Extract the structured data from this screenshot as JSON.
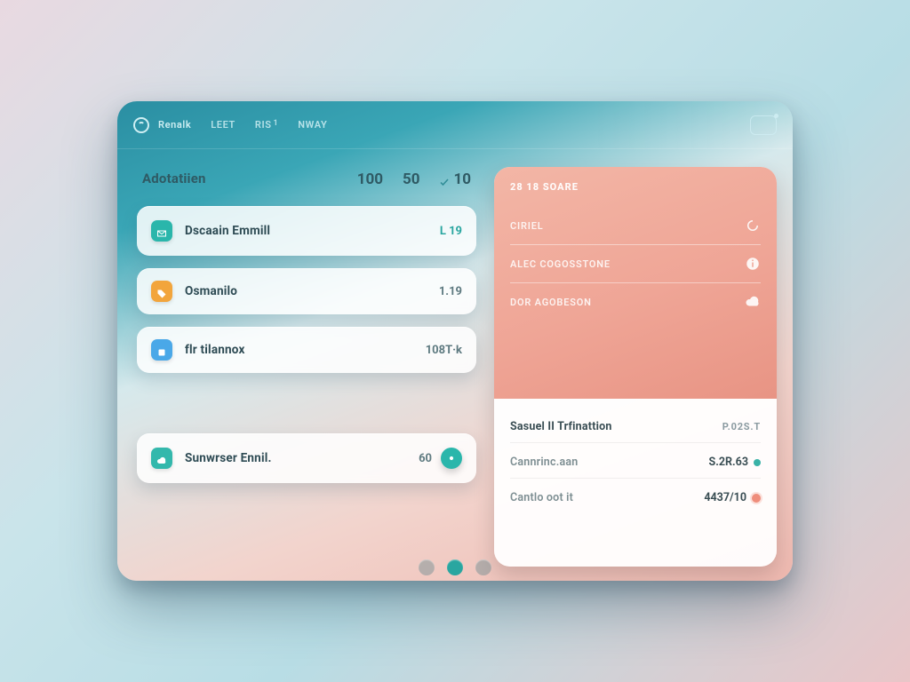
{
  "topbar": {
    "brand": "Renalk",
    "tabs": [
      {
        "label": "LEET"
      },
      {
        "label": "RIS",
        "badge": "1"
      },
      {
        "label": "NWAY"
      }
    ]
  },
  "left": {
    "title": "Adotatiien",
    "metrics": [
      {
        "value": "100",
        "caption": ""
      },
      {
        "value": "50",
        "caption": ""
      },
      {
        "value": "10",
        "caption": "",
        "check": true
      }
    ],
    "items": [
      {
        "icon": "mail-icon",
        "icon_bg": "bg-teal",
        "label": "Dscaain Emmill",
        "value": "L 19",
        "value_cls": "teal"
      },
      {
        "icon": "tag-icon",
        "icon_bg": "bg-orange",
        "label": "Osmanilo",
        "value": "1.19",
        "value_cls": "gray"
      },
      {
        "icon": "box-icon",
        "icon_bg": "bg-blue",
        "label": "flr tilannox",
        "value": "108T·k",
        "value_cls": "gray"
      },
      {
        "icon": "cloud-icon",
        "icon_bg": "bg-teal2",
        "label": "Sunwrser Ennil.",
        "value": "60",
        "value_cls": "gray",
        "badge": "●"
      }
    ]
  },
  "side": {
    "header": "28 18 SOARE",
    "rows": [
      {
        "label": "CIRIEL",
        "icon": "loop-icon"
      },
      {
        "label": "ALEC COGOSSTONE",
        "icon": "info-icon"
      },
      {
        "label": "DOR AGOBESON",
        "icon": "cloud-icon"
      }
    ],
    "bottom": [
      {
        "label": "Sasuel II Trfinattion",
        "value": "P.02S.T",
        "muted_val": true
      },
      {
        "label": "Cannrinc.aan",
        "value": "S.2R.63",
        "dot": "teal"
      },
      {
        "label": "Cantlo oot it",
        "value": "4437/10",
        "dot": "coral"
      }
    ]
  },
  "colors": {
    "teal": "#2ab6ab",
    "coral": "#ef8d7b"
  }
}
